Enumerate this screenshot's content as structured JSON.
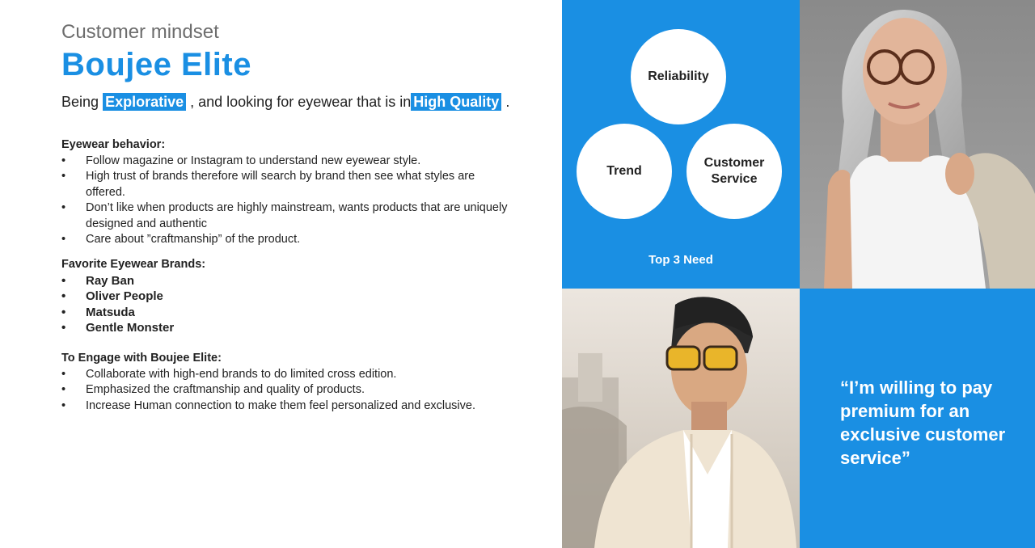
{
  "header": {
    "subtitle": "Customer mindset",
    "title": "Boujee Elite",
    "tagline_pre": "Being",
    "tagline_hl1": "Explorative",
    "tagline_mid": ", and looking for eyewear that is in",
    "tagline_hl2": "High Quality",
    "tagline_end": "."
  },
  "behavior": {
    "heading": "Eyewear behavior:",
    "items": [
      "Follow magazine or Instagram to understand new eyewear style.",
      "High trust of brands therefore will search by brand then see what styles are offered.",
      "Don’t like when products are highly mainstream, wants products that are uniquely designed and authentic",
      "Care about ”craftmanship” of the product."
    ]
  },
  "brands": {
    "heading": "Favorite Eyewear Brands:",
    "items": [
      "Ray Ban",
      "Oliver People",
      "Matsuda",
      "Gentle Monster"
    ]
  },
  "engage": {
    "heading": "To Engage with Boujee Elite:",
    "items": [
      "Collaborate with high-end brands to do limited cross edition.",
      "Emphasized the craftmanship and quality of products.",
      "Increase Human connection to make them feel personalized and exclusive."
    ]
  },
  "needs": {
    "circle1": "Reliability",
    "circle2": "Trend",
    "circle3_line1": "Customer",
    "circle3_line2": "Service",
    "label": "Top 3 Need"
  },
  "quote": "“I’m willing to pay premium for an exclusive customer service”",
  "colors": {
    "accent": "#1a8fe3"
  }
}
